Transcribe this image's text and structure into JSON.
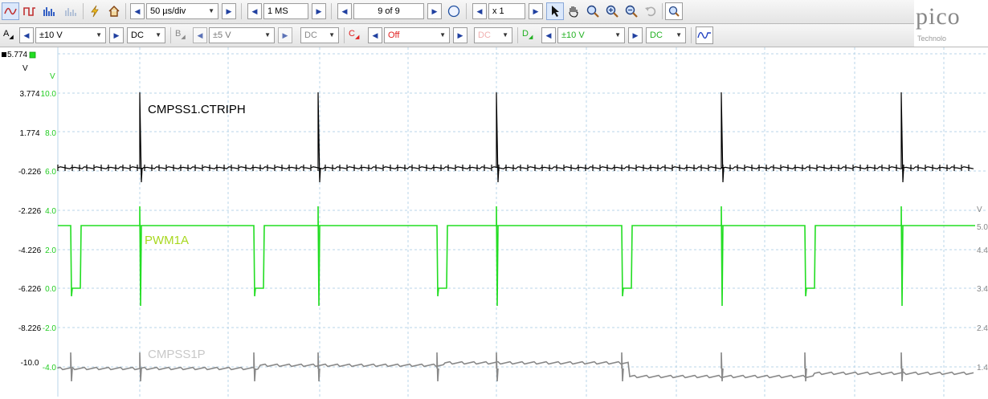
{
  "toolbar": {
    "timebase": "50 µs/div",
    "samples": "1 MS",
    "buffer": "9 of 9",
    "zoom": "x 1",
    "icons": [
      "scope-mode-icon",
      "persistence-mode-icon",
      "spectrum-mode-icon",
      "persistence-spectrum-icon",
      "trigger-icon",
      "home-icon",
      "auto-setup-icon",
      "pointer-icon",
      "hand-icon",
      "zoom-icon",
      "zoom-in-icon",
      "zoom-out-icon",
      "undo-zoom-icon",
      "zoom-overview-icon"
    ]
  },
  "logo": {
    "text": "pico",
    "subtext": "Technolo"
  },
  "channels": [
    {
      "letter": "A",
      "range": "±10 V",
      "coupling": "DC",
      "color": "#000000"
    },
    {
      "letter": "B",
      "range": "±5 V",
      "coupling": "DC",
      "color": "#888888"
    },
    {
      "letter": "C",
      "range": "Off",
      "coupling": "DC",
      "color": "#e02020"
    },
    {
      "letter": "D",
      "range": "±10 V",
      "coupling": "DC",
      "color": "#20cc20"
    }
  ],
  "math_icon": "math-waveform-icon",
  "axes": {
    "left_top_label": "5.774",
    "left_unit": "V",
    "left_ticks": [
      "3.774",
      "1.774",
      "-0.226",
      "-2.226",
      "-4.226",
      "-6.226",
      "-8.226",
      "-10.0"
    ],
    "inner_unit": "V",
    "inner_ticks": [
      "10.0",
      "8.0",
      "6.0",
      "4.0",
      "2.0",
      "0.0",
      "-2.0",
      "-4.0"
    ],
    "right_unit": "V",
    "right_ticks": [
      "5.0",
      "4.4",
      "3.4",
      "2.4",
      "1.4"
    ]
  },
  "traces": [
    {
      "name": "CMPSS1.CTRIPH",
      "color": "#000000"
    },
    {
      "name": "PWM1A",
      "color": "#a8d820",
      "trace_color": "#22dd22"
    },
    {
      "name": "CMPSS1P",
      "color": "#c8c8c8",
      "trace_color": "#888888"
    }
  ],
  "colors": {
    "grid": "#b9d4e8",
    "background": "#ffffff",
    "accent": "#2040a0"
  }
}
